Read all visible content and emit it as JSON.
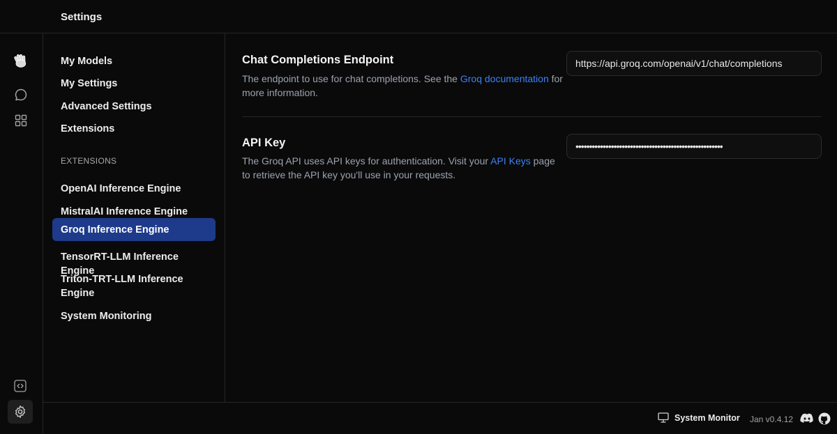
{
  "header": {
    "title": "Settings"
  },
  "rail": {
    "icons": [
      "waving-hand-icon",
      "chat-icon",
      "grid-icon",
      "code-icon",
      "gear-icon"
    ]
  },
  "sidebar": {
    "items": [
      {
        "label": "My Models"
      },
      {
        "label": "My Settings"
      },
      {
        "label": "Advanced Settings"
      },
      {
        "label": "Extensions"
      }
    ],
    "section_label": "EXTENSIONS",
    "extensions": [
      {
        "label": "OpenAI Inference Engine"
      },
      {
        "label": "MistralAI Inference Engine"
      },
      {
        "label": "Groq Inference Engine",
        "active": true
      },
      {
        "label": "TensorRT-LLM Inference Engine"
      },
      {
        "label": "Triton-TRT-LLM Inference Engine"
      },
      {
        "label": "System Monitoring"
      }
    ]
  },
  "settings": {
    "endpoint": {
      "title": "Chat Completions Endpoint",
      "desc_before": "The endpoint to use for chat completions. See the ",
      "link": "Groq documentation",
      "desc_after": " for more information.",
      "value": "https://api.groq.com/openai/v1/chat/completions"
    },
    "api_key": {
      "title": "API Key",
      "desc_before": "The Groq API uses API keys for authentication. Visit your ",
      "link": "API Keys",
      "desc_after": " page to retrieve the API key you'll use in your requests.",
      "value": "••••••••••••••••••••••••••••••••••••••••••••••••••••••"
    }
  },
  "footer": {
    "system_monitor": "System Monitor",
    "version": "Jan v0.4.12"
  },
  "colors": {
    "accent": "#1e3a8a",
    "link": "#3b82f6",
    "background": "#0a0a0a"
  }
}
